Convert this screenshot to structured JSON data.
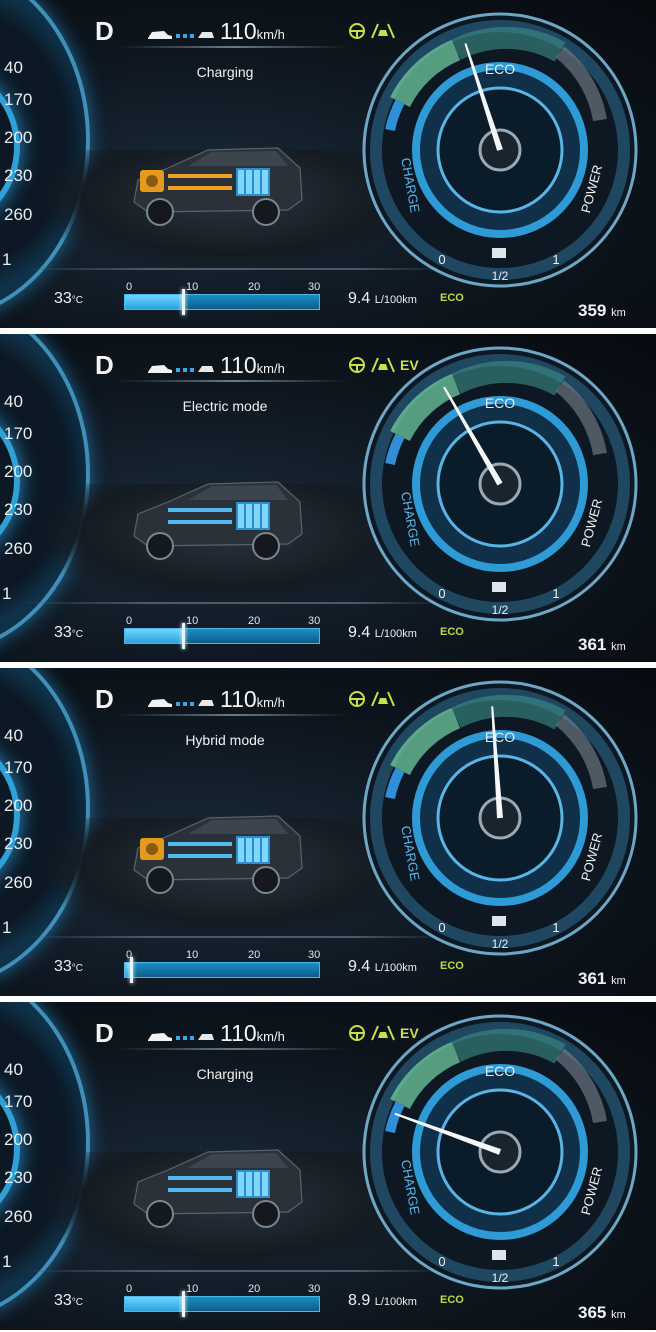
{
  "shared": {
    "gear": "D",
    "speed_value": "110",
    "speed_unit": "km/h",
    "speedo_ticks": [
      "40",
      "170",
      "200",
      "230",
      "260",
      "1"
    ],
    "temp_value": "33",
    "temp_unit": "°C",
    "econ_unit": "L/100km",
    "bar_scale": [
      "0",
      "10",
      "20",
      "30"
    ],
    "gauge_labels": {
      "eco": "ECO",
      "charge": "CHARGE",
      "power": "POWER",
      "zero": "0",
      "half": "1/2",
      "one": "1"
    },
    "eco_label": "ECO",
    "range_unit": "km"
  },
  "panels": [
    {
      "mode": "Charging",
      "ev": "",
      "econ_value": "9.4",
      "range_value": "359",
      "bar_fill_fraction": 0.3,
      "needle_angle_deg": -18,
      "engine_active": true,
      "flow_color": "#f0a020"
    },
    {
      "mode": "Electric mode",
      "ev": "EV",
      "econ_value": "9.4",
      "range_value": "361",
      "bar_fill_fraction": 0.3,
      "needle_angle_deg": -30,
      "engine_active": false,
      "flow_color": "#4fb9f0"
    },
    {
      "mode": "Hybrid mode",
      "ev": "",
      "econ_value": "9.4",
      "range_value": "361",
      "bar_fill_fraction": 0.03,
      "needle_angle_deg": -4,
      "engine_active": true,
      "flow_color": "#4fb9f0"
    },
    {
      "mode": "Charging",
      "ev": "EV",
      "econ_value": "8.9",
      "range_value": "365",
      "bar_fill_fraction": 0.3,
      "needle_angle_deg": -70,
      "engine_active": false,
      "flow_color": "#4fb9f0"
    }
  ]
}
